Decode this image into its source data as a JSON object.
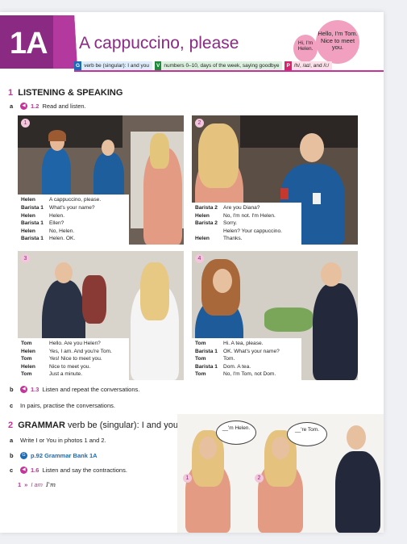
{
  "header": {
    "unit": "1A",
    "title": "A cappuccino, please",
    "bubble_big": "Hello, I'm Tom. Nice to meet you.",
    "bubble_small": "Hi, I'm Helen.",
    "tags": [
      {
        "letter": "G",
        "text": "verb be (singular): I and you"
      },
      {
        "letter": "V",
        "text": "numbers 0–10, days of the week, saying goodbye"
      },
      {
        "letter": "P",
        "text": "/h/, /aɪ/, and /i:/"
      }
    ]
  },
  "section1": {
    "num": "1",
    "title": "LISTENING & SPEAKING",
    "a": {
      "letter": "a",
      "track": "1.2",
      "text": "Read and listen."
    },
    "b": {
      "letter": "b",
      "track": "1.3",
      "text": "Listen and repeat the conversations."
    },
    "c": {
      "letter": "c",
      "text": "In pairs, practise the conversations."
    }
  },
  "photos": [
    {
      "num": "1",
      "lines": [
        {
          "who": "Helen",
          "say": "A cappuccino, please."
        },
        {
          "who": "Barista 1",
          "say": "What's your name?"
        },
        {
          "who": "Helen",
          "say": "Helen."
        },
        {
          "who": "Barista 1",
          "say": "Ellen?"
        },
        {
          "who": "Helen",
          "say": "No, Helen."
        },
        {
          "who": "Barista 1",
          "say": "Helen. OK."
        }
      ]
    },
    {
      "num": "2",
      "lines": [
        {
          "who": "Barista 2",
          "say": "Are you Diana?"
        },
        {
          "who": "Helen",
          "say": "No, I'm not. I'm Helen."
        },
        {
          "who": "Barista 2",
          "say": "Sorry."
        },
        {
          "who": "",
          "say": "Helen? Your cappuccino."
        },
        {
          "who": "Helen",
          "say": "Thanks."
        }
      ]
    },
    {
      "num": "3",
      "lines": [
        {
          "who": "Tom",
          "say": "Hello. Are you Helen?"
        },
        {
          "who": "Helen",
          "say": "Yes, I am. And you're Tom."
        },
        {
          "who": "Tom",
          "say": "Yes! Nice to meet you."
        },
        {
          "who": "Helen",
          "say": "Nice to meet you."
        },
        {
          "who": "Tom",
          "say": "Just a minute."
        }
      ]
    },
    {
      "num": "4",
      "lines": [
        {
          "who": "Tom",
          "say": "Hi. A tea, please."
        },
        {
          "who": "Barista 1",
          "say": "OK. What's your name?"
        },
        {
          "who": "Tom",
          "say": "Tom."
        },
        {
          "who": "Barista 1",
          "say": "Dom. A tea."
        },
        {
          "who": "Tom",
          "say": "No, I'm Tom, not Dom."
        }
      ]
    }
  ],
  "section2": {
    "num": "2",
    "title": "GRAMMAR",
    "subtitle": "verb be (singular): I and you",
    "a": {
      "letter": "a",
      "text": "Write I or You in photos 1 and 2."
    },
    "b": {
      "letter": "b",
      "ref": "p.92 Grammar Bank 1A"
    },
    "c": {
      "letter": "c",
      "track": "1.6",
      "text": "Listen and say the contractions."
    },
    "example": {
      "num": "1",
      "text": "I am",
      "answer": "I'm"
    },
    "speech1": "__'m Helen.",
    "speech2": "__'re Tom.",
    "fig1": "1",
    "fig2": "2"
  },
  "colors": {
    "brand": "#8a2a83",
    "accent": "#c3339a",
    "grammar": "#1c6bb6"
  }
}
